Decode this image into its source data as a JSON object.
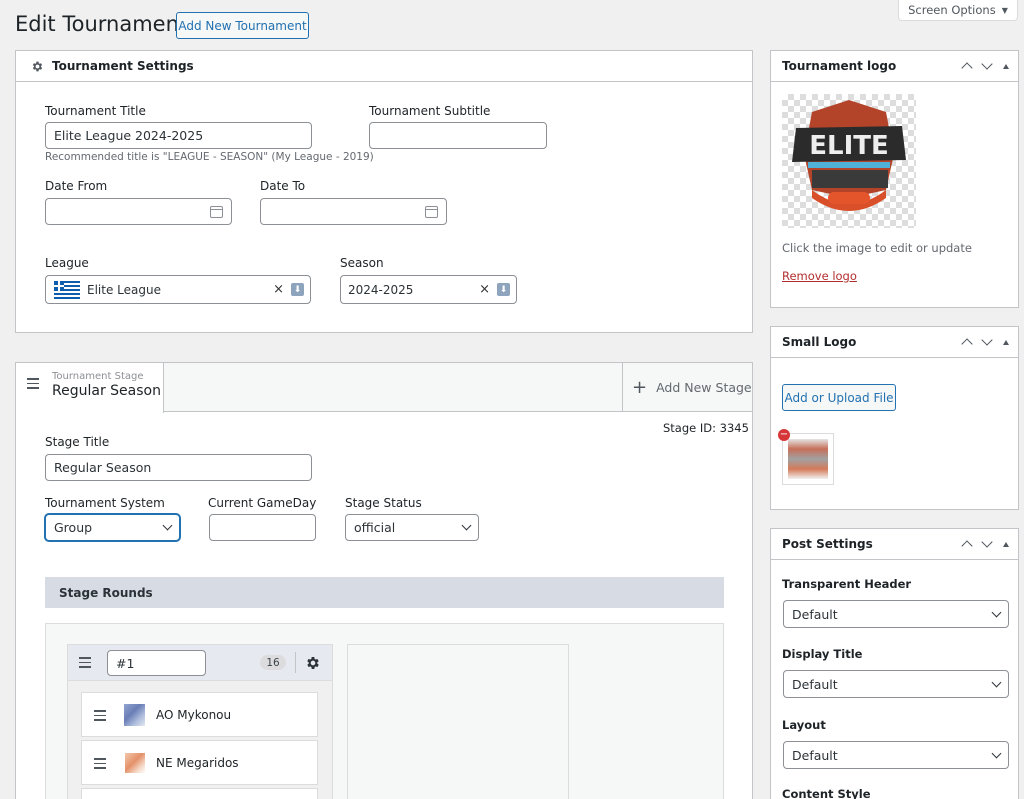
{
  "header": {
    "title": "Edit Tournament",
    "add_new_label": "Add New Tournament",
    "screen_options_label": "Screen Options"
  },
  "settings_box": {
    "title": "Tournament Settings",
    "tournament_title_label": "Tournament Title",
    "tournament_title_value": "Elite League 2024-2025",
    "tournament_title_hint": "Recommended title is \"LEAGUE - SEASON\" (My League - 2019)",
    "subtitle_label": "Tournament Subtitle",
    "subtitle_value": "",
    "date_from_label": "Date From",
    "date_from_value": "",
    "date_to_label": "Date To",
    "date_to_value": "",
    "league_label": "League",
    "league_value": "Elite League",
    "season_label": "Season",
    "season_value": "2024-2025"
  },
  "stage": {
    "tab_small_label": "Tournament Stage",
    "tab_name": "Regular Season",
    "add_stage_label": "Add New Stage",
    "stage_id_text": "Stage ID: 3345",
    "stage_title_label": "Stage Title",
    "stage_title_value": "Regular Season",
    "system_label": "Tournament System",
    "system_value": "Group",
    "gameday_label": "Current GameDay",
    "gameday_value": "",
    "status_label": "Stage Status",
    "status_value": "official",
    "rounds_title": "Stage Rounds",
    "round_name_value": "#1",
    "round_count": "16",
    "teams": [
      {
        "name": "AO Mykonou"
      },
      {
        "name": "NE Megaridos"
      }
    ]
  },
  "sidebar": {
    "logo_box": {
      "title": "Tournament logo",
      "hint": "Click the image to edit or update",
      "remove_label": "Remove logo"
    },
    "small_logo_box": {
      "title": "Small Logo",
      "upload_label": "Add or Upload File"
    },
    "post_settings": {
      "title": "Post Settings",
      "transparent_header_label": "Transparent Header",
      "transparent_header_value": "Default",
      "display_title_label": "Display Title",
      "display_title_value": "Default",
      "layout_label": "Layout",
      "layout_value": "Default",
      "content_style_label": "Content Style"
    }
  },
  "colors": {
    "accent": "#2271b1",
    "link_danger": "#b32d2e",
    "rounds_header_bg": "#d6dbe4"
  },
  "icons": [
    "gear-icon",
    "calendar-icon",
    "greek-flag-icon",
    "clear-icon",
    "download-icon",
    "hamburger-icon",
    "plus-icon",
    "chevron-down-icon",
    "chevron-up-icon",
    "remove-icon"
  ]
}
